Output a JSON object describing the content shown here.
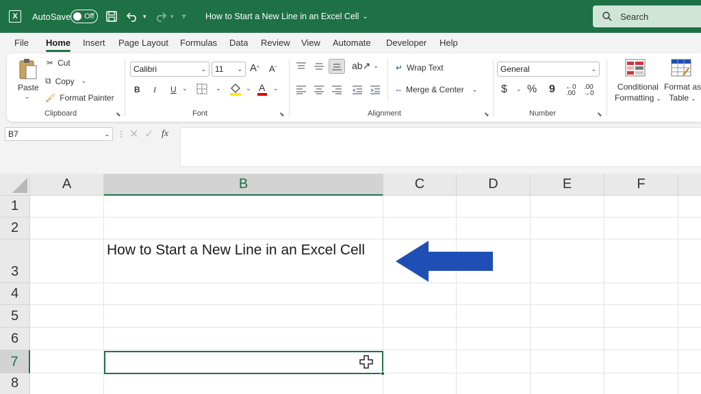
{
  "titlebar": {
    "autosave_label": "AutoSave",
    "toggle_state": "Off",
    "document_title": "How to Start a New Line in an Excel Cell",
    "search_placeholder": "Search",
    "bg_color": "#1e7145"
  },
  "menu": {
    "tabs": [
      "File",
      "Home",
      "Insert",
      "Page Layout",
      "Formulas",
      "Data",
      "Review",
      "View",
      "Automate",
      "Developer",
      "Help"
    ],
    "active_tab": "Home"
  },
  "ribbon": {
    "clipboard": {
      "paste": "Paste",
      "cut": "Cut",
      "copy": "Copy",
      "format_painter": "Format Painter",
      "group_label": "Clipboard"
    },
    "font": {
      "font_name": "Calibri",
      "font_size": "11",
      "bold": "B",
      "italic": "I",
      "underline": "U",
      "group_label": "Font"
    },
    "alignment": {
      "wrap_text": "Wrap Text",
      "merge_center": "Merge & Center",
      "group_label": "Alignment"
    },
    "number": {
      "format": "General",
      "currency": "$",
      "percent": "%",
      "comma": "9",
      "group_label": "Number"
    },
    "styles": {
      "conditional_1": "Conditional",
      "conditional_2": "Formatting",
      "format_table_1": "Format as",
      "format_table_2": "Table"
    }
  },
  "formula_bar": {
    "name_box": "B7",
    "fx": "fx",
    "value": ""
  },
  "sheet": {
    "columns": [
      "A",
      "B",
      "C",
      "D",
      "E",
      "F"
    ],
    "selected_column": "B",
    "rows": [
      "1",
      "2",
      "3",
      "4",
      "5",
      "6",
      "7",
      "8"
    ],
    "selected_row": "7",
    "cell_B3": "How to Start a New Line in an Excel Cell"
  },
  "annotation": {
    "arrow_color": "#1f4fb4",
    "direction": "left"
  },
  "colors": {
    "accent": "#1e7145",
    "header_bg": "#e9e9e9",
    "selected_header_bg": "#d3d3d3"
  }
}
